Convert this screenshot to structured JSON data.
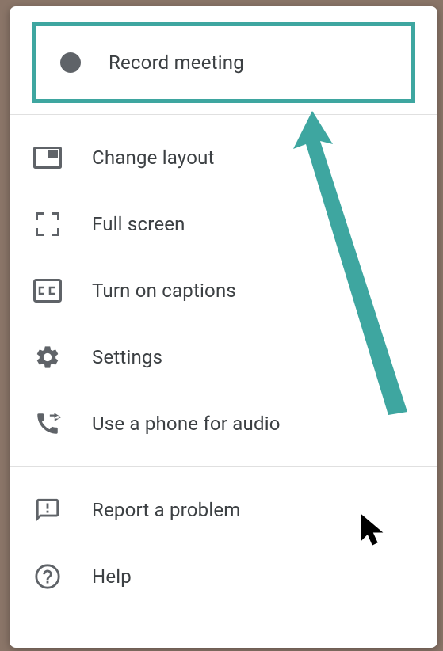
{
  "menu": {
    "sections": [
      {
        "items": [
          {
            "id": "record",
            "label": "Record meeting",
            "highlighted": true
          }
        ]
      },
      {
        "items": [
          {
            "id": "layout",
            "label": "Change layout"
          },
          {
            "id": "fullscreen",
            "label": "Full screen"
          },
          {
            "id": "captions",
            "label": "Turn on captions"
          },
          {
            "id": "settings",
            "label": "Settings"
          },
          {
            "id": "phone",
            "label": "Use a phone for audio"
          }
        ]
      },
      {
        "items": [
          {
            "id": "report",
            "label": "Report a problem"
          },
          {
            "id": "help",
            "label": "Help"
          }
        ]
      }
    ]
  },
  "colors": {
    "highlight_border": "#3ea6a0",
    "arrow": "#3ea6a0",
    "icon_gray": "#5f6368",
    "text": "#3c4043"
  }
}
